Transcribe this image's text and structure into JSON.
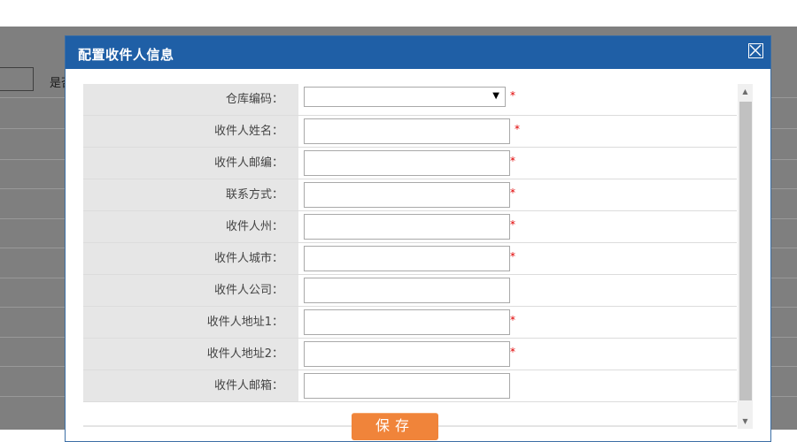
{
  "background": {
    "label_partial": "是否"
  },
  "dialog": {
    "title": "配置收件人信息",
    "close_icon": "close-box-icon",
    "fields": [
      {
        "label": "仓库编码：",
        "type": "select",
        "value": "",
        "required": true
      },
      {
        "label": "收件人姓名：",
        "type": "text",
        "value": "",
        "required": true
      },
      {
        "label": "收件人邮编：",
        "type": "text",
        "value": "",
        "required": true
      },
      {
        "label": "联系方式：",
        "type": "text",
        "value": "",
        "required": true
      },
      {
        "label": "收件人州：",
        "type": "text",
        "value": "",
        "required": true
      },
      {
        "label": "收件人城市：",
        "type": "text",
        "value": "",
        "required": true
      },
      {
        "label": "收件人公司：",
        "type": "text",
        "value": "",
        "required": false
      },
      {
        "label": "收件人地址1：",
        "type": "text",
        "value": "",
        "required": true
      },
      {
        "label": "收件人地址2：",
        "type": "text",
        "value": "",
        "required": true
      },
      {
        "label": "收件人邮箱：",
        "type": "text",
        "value": "",
        "required": false
      }
    ],
    "required_mark": "*",
    "select_arrow": "▼",
    "save_label": "保存"
  },
  "colors": {
    "header": "#1f5fa6",
    "label_bg": "#e6e6e6",
    "save_button": "#f0843a",
    "required": "#e00000",
    "overlay": "#7f7f7f"
  }
}
